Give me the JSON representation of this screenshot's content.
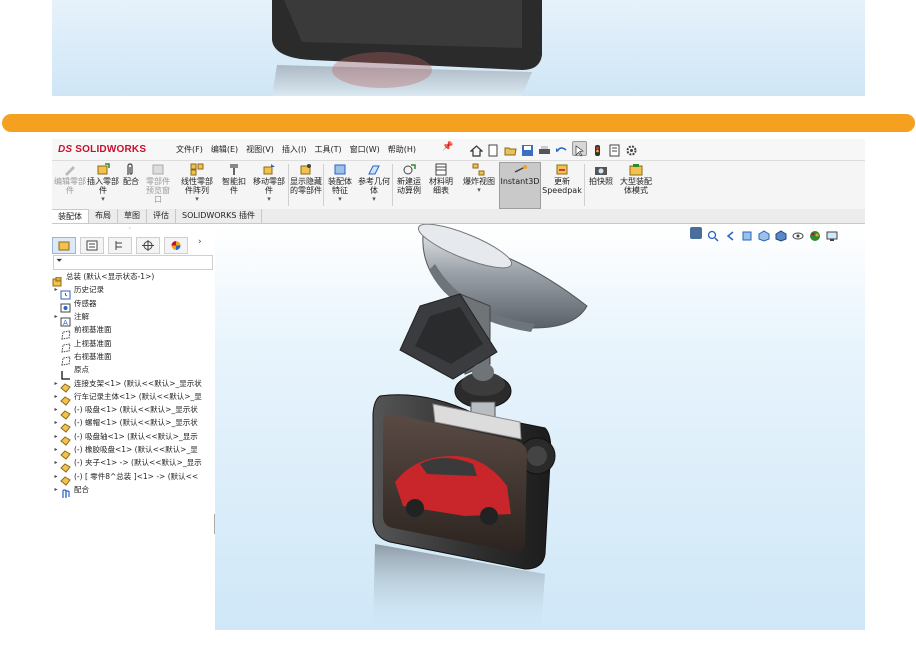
{
  "window": {
    "logo_ds": "DS",
    "logo_text": "SOLIDWORKS"
  },
  "menu": [
    "文件(F)",
    "编辑(E)",
    "视图(V)",
    "插入(I)",
    "工具(T)",
    "窗口(W)",
    "帮助(H)"
  ],
  "toolbar": {
    "edit_part": "编辑零部件",
    "insert_part": "插入零部件",
    "mate": "配合",
    "component_preview": "零部件预览窗口",
    "linear_pattern": "线性零部件阵列",
    "smart_fastener": "智能扣件",
    "move_component": "移动零部件",
    "show_hidden": "显示隐藏的零部件",
    "assembly_feature": "装配体特征",
    "reference_geometry": "参考几何体",
    "new_motion_study": "新建运动算例",
    "bom": "材料明细表",
    "exploded_view": "爆炸视图",
    "instant3d": "Instant3D",
    "update_speedpak": "更新Speedpak",
    "snapshot": "拍快照",
    "large_assembly": "大型装配体模式"
  },
  "tabs": [
    "装配体",
    "布局",
    "草图",
    "评估",
    "SOLIDWORKS 插件"
  ],
  "tree": {
    "root": "总装 (默认<显示状态-1>)",
    "items": [
      {
        "label": "历史记录",
        "expand": "▸",
        "icon": "history-icon"
      },
      {
        "label": "传感器",
        "expand": "",
        "icon": "sensor-icon"
      },
      {
        "label": "注解",
        "expand": "▸",
        "icon": "annotation-icon"
      },
      {
        "label": "前视基准面",
        "expand": "",
        "icon": "plane-icon"
      },
      {
        "label": "上视基准面",
        "expand": "",
        "icon": "plane-icon"
      },
      {
        "label": "右视基准面",
        "expand": "",
        "icon": "plane-icon"
      },
      {
        "label": "原点",
        "expand": "",
        "icon": "origin-icon"
      },
      {
        "label": "连接支架<1> (默认<<默认>_显示状",
        "expand": "▸",
        "icon": "part-icon"
      },
      {
        "label": "行车记录主体<1> (默认<<默认>_显",
        "expand": "▸",
        "icon": "part-icon"
      },
      {
        "label": "(-) 吸盘<1> (默认<<默认>_显示状",
        "expand": "▸",
        "icon": "part-icon"
      },
      {
        "label": "(-) 螺帽<1> (默认<<默认>_显示状",
        "expand": "▸",
        "icon": "part-icon"
      },
      {
        "label": "(-) 吸盘轴<1> (默认<<默认>_显示",
        "expand": "▸",
        "icon": "part-icon"
      },
      {
        "label": "(-) 橡胶吸盘<1> (默认<<默认>_显",
        "expand": "▸",
        "icon": "part-icon"
      },
      {
        "label": "(-) 夹子<1> -> (默认<<默认>_显示",
        "expand": "▸",
        "icon": "part-icon"
      },
      {
        "label": "(-) [ 零件8^总装 ]<1> -> (默认<<",
        "expand": "▸",
        "icon": "part-icon"
      },
      {
        "label": "配合",
        "expand": "▸",
        "icon": "mate-icon"
      }
    ]
  },
  "colors": {
    "accent_orange": "#f5a11f",
    "brand_red": "#c8102e",
    "viewport_blue": "#cfe7f7"
  }
}
